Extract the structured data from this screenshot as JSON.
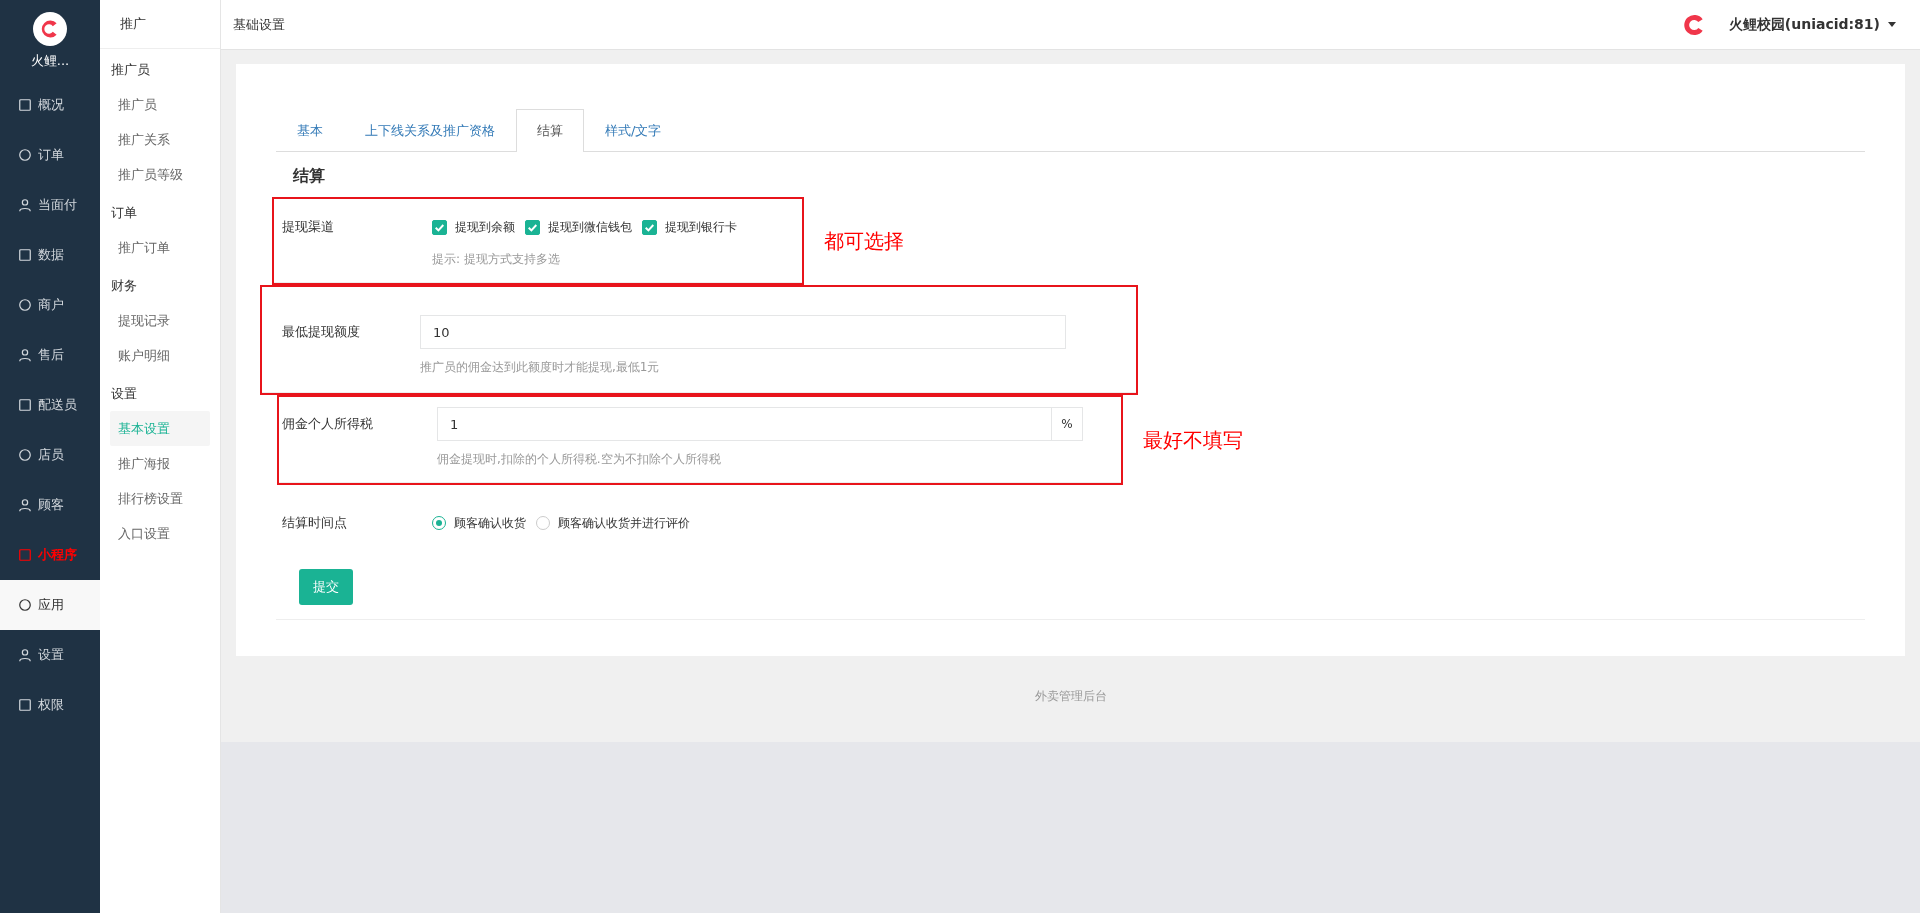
{
  "brand": {
    "name": "火鲤..."
  },
  "nav": [
    {
      "label": "概况",
      "selected": false,
      "highlighted": false
    },
    {
      "label": "订单",
      "selected": false,
      "highlighted": false
    },
    {
      "label": "当面付",
      "selected": false,
      "highlighted": false
    },
    {
      "label": "数据",
      "selected": false,
      "highlighted": false
    },
    {
      "label": "商户",
      "selected": false,
      "highlighted": false
    },
    {
      "label": "售后",
      "selected": false,
      "highlighted": false
    },
    {
      "label": "配送员",
      "selected": false,
      "highlighted": false
    },
    {
      "label": "店员",
      "selected": false,
      "highlighted": false
    },
    {
      "label": "顾客",
      "selected": false,
      "highlighted": false
    },
    {
      "label": "小程序",
      "selected": false,
      "highlighted": true
    },
    {
      "label": "应用",
      "selected": true,
      "highlighted": false
    },
    {
      "label": "设置",
      "selected": false,
      "highlighted": false
    },
    {
      "label": "权限",
      "selected": false,
      "highlighted": false
    }
  ],
  "subnav": {
    "title": "推广",
    "groups": [
      {
        "label": "推广员",
        "children": [
          {
            "label": "推广员",
            "selected": false
          },
          {
            "label": "推广关系",
            "selected": false
          },
          {
            "label": "推广员等级",
            "selected": false
          }
        ]
      },
      {
        "label": "订单",
        "children": [
          {
            "label": "推广订单",
            "selected": false
          }
        ]
      },
      {
        "label": "财务",
        "children": [
          {
            "label": "提现记录",
            "selected": false
          },
          {
            "label": "账户明细",
            "selected": false
          }
        ]
      },
      {
        "label": "设置",
        "children": [
          {
            "label": "基本设置",
            "selected": true
          },
          {
            "label": "推广海报",
            "selected": false
          },
          {
            "label": "排行榜设置",
            "selected": false
          },
          {
            "label": "入口设置",
            "selected": false
          }
        ]
      }
    ]
  },
  "header": {
    "title": "基础设置",
    "account": "火鲤校园(uniacid:81)"
  },
  "tabs": [
    {
      "label": "基本",
      "selected": false
    },
    {
      "label": "上下线关系及推广资格",
      "selected": false
    },
    {
      "label": "结算",
      "selected": true
    },
    {
      "label": "样式/文字",
      "selected": false
    }
  ],
  "section_title": "结算",
  "fields": [
    {
      "kind": "checkboxes",
      "label": "提现渠道",
      "annotated": true,
      "note": "都可选择",
      "options": [
        {
          "label": "提现到余额",
          "checked": true
        },
        {
          "label": "提现到微信钱包",
          "checked": true
        },
        {
          "label": "提现到银行卡",
          "checked": true
        }
      ],
      "hint": "提示: 提现方式支持多选"
    },
    {
      "kind": "input",
      "label": "最低提现额度",
      "annotated": true,
      "value": "10",
      "hint": "推广员的佣金达到此额度时才能提现,最低1元"
    },
    {
      "kind": "input",
      "label": "佣金个人所得税",
      "annotated": true,
      "note": "最好不填写",
      "value": "1",
      "suffix": "%",
      "hint": "佣金提现时,扣除的个人所得税.空为不扣除个人所得税"
    },
    {
      "kind": "radios",
      "label": "结算时间点",
      "annotated": false,
      "options": [
        {
          "label": "顾客确认收货",
          "selected": true
        },
        {
          "label": "顾客确认收货并进行评价",
          "selected": false
        }
      ]
    }
  ],
  "submit": "提交",
  "footer": "外卖管理后台"
}
